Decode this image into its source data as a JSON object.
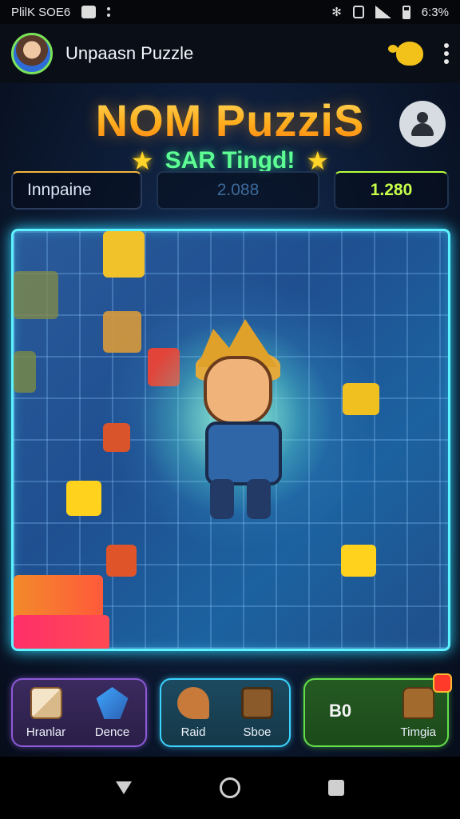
{
  "status_bar": {
    "left_text": "PlilK SOE6",
    "battery_text": "6:3%",
    "icons": [
      "square-icon",
      "dots-icon",
      "bluetooth-icon",
      "vibrate-icon",
      "signal-icon",
      "battery-icon"
    ]
  },
  "app_bar": {
    "title": "Unpaasn Puzzle",
    "avatar": "avatar",
    "icons": [
      "mascot-icon",
      "more-vert-icon"
    ]
  },
  "header": {
    "logo": "NOM PuzziS",
    "subtitle": "SAR Tingd!",
    "star_left": "★",
    "star_right": "★"
  },
  "scores": {
    "left_label": "Innpaine",
    "middle_value": "2.088",
    "right_value": "1.280"
  },
  "bottom_panel": {
    "purple_card": {
      "slot1_label": "Hranlar",
      "slot2_label": "Dence"
    },
    "teal_card": {
      "slot1_label": "Raid",
      "slot2_label": "Sboe"
    },
    "green_card": {
      "value": "B0",
      "label": "Timgia"
    }
  },
  "colors": {
    "logo_gradient_top": "#ffe36b",
    "logo_gradient_bottom": "#ff7b12",
    "subtitle_green": "#5dff94",
    "board_border": "#5cf2ff",
    "score_right": "#c8ff4a"
  }
}
